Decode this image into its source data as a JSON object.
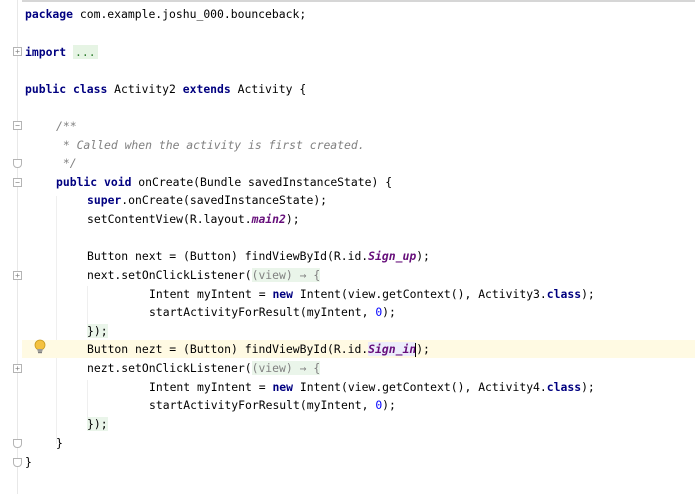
{
  "colors": {
    "keyword": "#000080",
    "field": "#660e7a",
    "comment": "#808080",
    "number": "#0000ff",
    "caret_row": "#fffae3",
    "folded_region": "#e6f4e4"
  },
  "gutter": {
    "bulb_icon": "intention-bulb-icon"
  },
  "code": {
    "l1_package": "package",
    "l1_name": " com.example.joshu_000.bounceback;",
    "l2_import": "import",
    "l2_folded": "...",
    "l3_public": "public",
    "l3_class": "class",
    "l3_name": " Activity2 ",
    "l3_extends": "extends",
    "l3_rest": " Activity {",
    "c1": "/**",
    "c2": " * Called when the activity is first created.",
    "c3": " */",
    "m_public": "public",
    "m_void": "void",
    "m_rest": " onCreate(Bundle savedInstanceState) {",
    "s_super": "super",
    "s_rest": ".onCreate(savedInstanceState);",
    "scv_pre": "setContentView(R.layout.",
    "scv_field": "main2",
    "scv_post": ");",
    "b1_pre": "Button next = (Button) findViewById(R.id.",
    "b1_field": "Sign_up",
    "b1_post": ");",
    "l1_pre": "next.setOnClickListener(",
    "l1_lambda": "(view) → {",
    "i1_pre": "Intent myIntent = ",
    "i1_new": "new",
    "i1_mid": " Intent(view.getContext(), Activity3.",
    "i1_class": "class",
    "i1_post": ");",
    "sa1_pre": "startActivityForResult(myIntent, ",
    "sa1_num": "0",
    "sa1_post": ");",
    "close1": "});",
    "b2_pre": "Button nezt = (Button) findViewById(R.id.",
    "b2_field": "Sign_in",
    "b2_post": ");",
    "l2_pre": "nezt.setOnClickListener(",
    "l2_lambda": "(view) → {",
    "i2_pre": "Intent myIntent = ",
    "i2_new": "new",
    "i2_mid": " Intent(view.getContext(), Activity4.",
    "i2_class": "class",
    "i2_post": ");",
    "sa2_pre": "startActivityForResult(myIntent, ",
    "sa2_num": "0",
    "sa2_post": ");",
    "close2": "});",
    "close_method": "}",
    "close_class": "}"
  }
}
